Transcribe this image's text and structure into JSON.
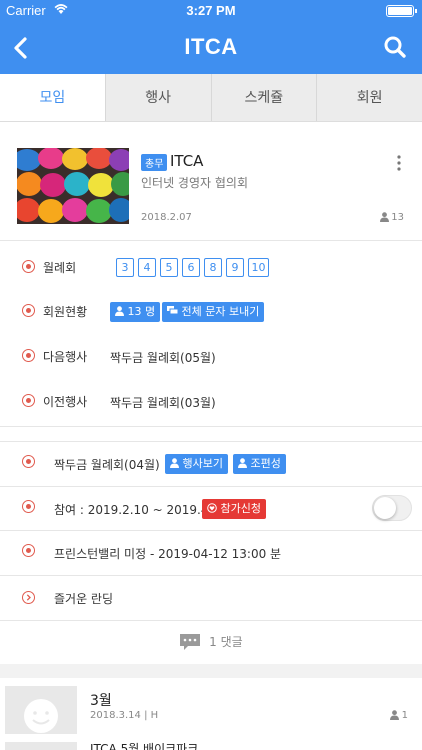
{
  "status": {
    "carrier": "Carrier",
    "time": "3:27 PM"
  },
  "nav": {
    "title": "ITCA"
  },
  "tabs": [
    "모임",
    "행사",
    "스케쥴",
    "회원"
  ],
  "group": {
    "badge": "총무",
    "name": "ITCA",
    "subtitle": "인터넷 경영자 협의회",
    "date": "2018.2.07",
    "members": "13"
  },
  "rows": {
    "monthly": {
      "label": "월례회",
      "numbers": [
        "3",
        "4",
        "5",
        "6",
        "8",
        "9",
        "10"
      ]
    },
    "members": {
      "label": "회원현황",
      "count_btn": "13 명",
      "sms_btn": "전체 문자 보내기"
    },
    "next": {
      "label": "다음행사",
      "value": "짝두금 월례회(05월)"
    },
    "prev": {
      "label": "이전행사",
      "value": "짝두금 월례회(03월)"
    }
  },
  "event": {
    "title": "짝두금 월례회(04월)",
    "view_btn": "행사보기",
    "team_btn": "조편성",
    "participation": "참여 : 2019.2.10 ~ 2019.4.09",
    "join_btn": "참가신청",
    "place": "프린스턴밸리 미정 - 2019-04-12 13:00 분",
    "note": "즐거운 란딩"
  },
  "comments": "1 댓글",
  "list": [
    {
      "title": "3월",
      "date": "2018.3.14 | H",
      "count": "1"
    },
    {
      "title": "ITCA 5월 배이크파크"
    }
  ],
  "colors": {
    "primary": "#3f8ff0",
    "danger": "#e53935",
    "icon": "#e05a4e"
  }
}
